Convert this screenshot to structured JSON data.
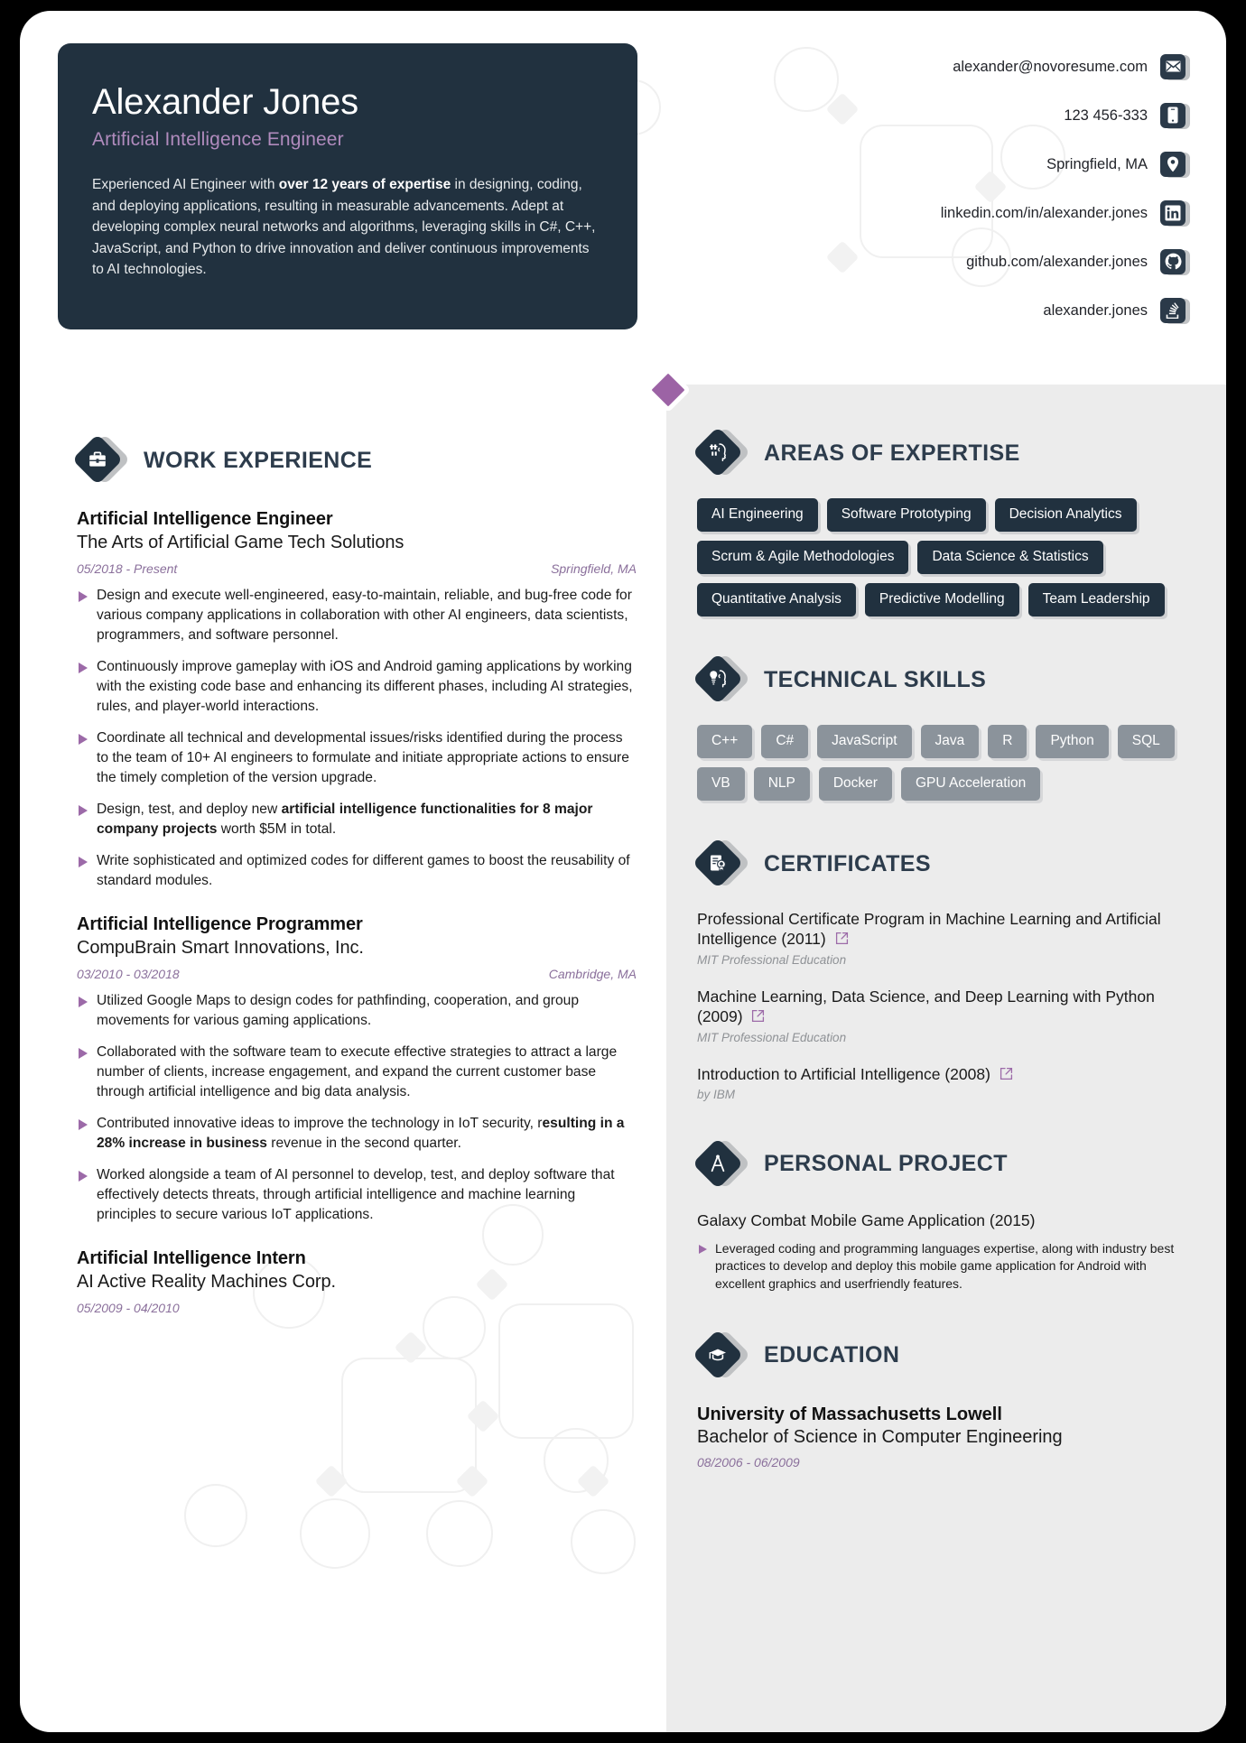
{
  "header": {
    "name": "Alexander Jones",
    "title": "Artificial Intelligence Engineer",
    "summary_part1": "Experienced AI Engineer with ",
    "summary_bold": "over 12 years of expertise",
    "summary_part2": " in designing, coding, and deploying applications, resulting in measurable advancements. Adept at developing complex neural networks and algorithms, leveraging skills in C#, C++, JavaScript, and Python to drive innovation and deliver continuous improvements to AI technologies."
  },
  "contact": [
    {
      "text": "alexander@novoresume.com",
      "icon": "envelope-icon"
    },
    {
      "text": "123 456-333",
      "icon": "phone-icon"
    },
    {
      "text": "Springfield, MA",
      "icon": "location-pin-icon"
    },
    {
      "text": "linkedin.com/in/alexander.jones",
      "icon": "linkedin-icon"
    },
    {
      "text": "github.com/alexander.jones",
      "icon": "github-icon"
    },
    {
      "text": "alexander.jones",
      "icon": "stackoverflow-icon"
    }
  ],
  "work": {
    "section_title": "WORK EXPERIENCE",
    "icon": "briefcase-icon",
    "jobs": [
      {
        "title": "Artificial Intelligence Engineer",
        "company": "The Arts of Artificial Game Tech Solutions",
        "dates": "05/2018 - Present",
        "location": "Springfield, MA",
        "bullets": [
          {
            "pre": "Design and execute well-engineered, easy-to-maintain, reliable, and bug-free code for various company applications in collaboration with other AI engineers, data scientists, programmers, and software personnel.",
            "bold": "",
            "post": ""
          },
          {
            "pre": "Continuously improve gameplay with iOS and Android gaming applications by working with the existing code base and enhancing its different phases, including AI strategies, rules, and player-world interactions.",
            "bold": "",
            "post": ""
          },
          {
            "pre": "Coordinate all technical and developmental issues/risks identified during the process to the team of 10+ AI engineers to formulate and initiate appropriate actions to ensure the timely completion of the version upgrade.",
            "bold": "",
            "post": ""
          },
          {
            "pre": "Design, test, and deploy new ",
            "bold": "artificial intelligence functionalities for 8 major company projects",
            "post": " worth $5M in total."
          },
          {
            "pre": "Write sophisticated and optimized codes for different games to boost the reusability of standard modules.",
            "bold": "",
            "post": ""
          }
        ]
      },
      {
        "title": "Artificial Intelligence Programmer",
        "company": "CompuBrain Smart Innovations, Inc.",
        "dates": "03/2010 - 03/2018",
        "location": "Cambridge, MA",
        "bullets": [
          {
            "pre": "Utilized Google Maps to design codes for pathfinding, cooperation, and group movements for various gaming applications.",
            "bold": "",
            "post": ""
          },
          {
            "pre": "Collaborated with the software team to execute effective strategies to attract a large number of clients, increase engagement, and expand the current customer base through artificial intelligence and big data analysis.",
            "bold": "",
            "post": ""
          },
          {
            "pre": "Contributed innovative ideas to improve the technology in IoT security, r",
            "bold": "esulting in a 28% increase in business",
            "post": " revenue in the second quarter."
          },
          {
            "pre": "Worked alongside a team of AI personnel to develop, test, and deploy software that effectively detects threats, through artificial intelligence and machine learning principles to secure various IoT applications.",
            "bold": "",
            "post": ""
          }
        ]
      },
      {
        "title": "Artificial Intelligence Intern",
        "company": "AI Active Reality Machines Corp.",
        "dates": "05/2009 - 04/2010",
        "location": "",
        "bullets": []
      }
    ]
  },
  "expertise": {
    "section_title": "AREAS OF EXPERTISE",
    "icon": "ai-head-gear-icon",
    "tags": [
      "AI Engineering",
      "Software Prototyping",
      "Decision Analytics",
      "Scrum & Agile Methodologies",
      "Data Science & Statistics",
      "Quantitative Analysis",
      "Predictive Modelling",
      "Team Leadership"
    ]
  },
  "technical_skills": {
    "section_title": "TECHNICAL SKILLS",
    "icon": "ai-head-bulb-icon",
    "tags": [
      "C++",
      "C#",
      "JavaScript",
      "Java",
      "R",
      "Python",
      "SQL",
      "VB",
      "NLP",
      "Docker",
      "GPU Acceleration"
    ]
  },
  "certificates": {
    "section_title": "CERTIFICATES",
    "icon": "certificate-icon",
    "items": [
      {
        "name": "Professional Certificate Program in Machine Learning and Artificial Intelligence (2011)",
        "issuer": "MIT Professional Education",
        "link_icon": "external-link-icon"
      },
      {
        "name": "Machine Learning, Data Science, and Deep Learning with Python (2009)",
        "issuer": "MIT Professional Education",
        "link_icon": "external-link-icon"
      },
      {
        "name": "Introduction to Artificial Intelligence (2008)",
        "issuer": "by IBM",
        "link_icon": "external-link-icon"
      }
    ]
  },
  "personal_project": {
    "section_title": "PERSONAL PROJECT",
    "icon": "compass-icon",
    "name": "Galaxy Combat Mobile Game Application (2015)",
    "bullets": [
      "Leveraged coding and programming languages expertise, along with industry best practices to develop and deploy this mobile game application for Android with excellent graphics and userfriendly features."
    ]
  },
  "education": {
    "section_title": "EDUCATION",
    "icon": "graduation-cap-icon",
    "school": "University of Massachusetts Lowell",
    "degree": "Bachelor of Science in Computer Engineering",
    "dates": "08/2006 - 06/2009"
  },
  "colors": {
    "dark": "#21313f",
    "accent_purple": "#9c63a5",
    "panel_grey": "#ececec",
    "tag_grey": "#8b939b"
  }
}
